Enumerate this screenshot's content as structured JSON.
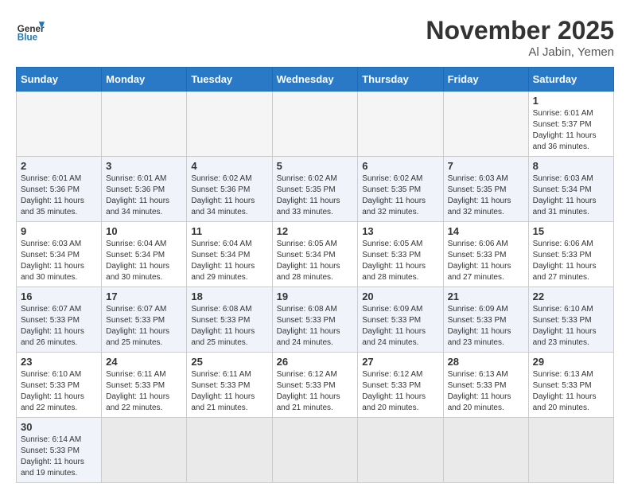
{
  "header": {
    "logo_general": "General",
    "logo_blue": "Blue",
    "month_title": "November 2025",
    "location": "Al Jabin, Yemen"
  },
  "weekdays": [
    "Sunday",
    "Monday",
    "Tuesday",
    "Wednesday",
    "Thursday",
    "Friday",
    "Saturday"
  ],
  "weeks": [
    [
      {
        "day": "",
        "info": ""
      },
      {
        "day": "",
        "info": ""
      },
      {
        "day": "",
        "info": ""
      },
      {
        "day": "",
        "info": ""
      },
      {
        "day": "",
        "info": ""
      },
      {
        "day": "",
        "info": ""
      },
      {
        "day": "1",
        "info": "Sunrise: 6:01 AM\nSunset: 5:37 PM\nDaylight: 11 hours and 36 minutes."
      }
    ],
    [
      {
        "day": "2",
        "info": "Sunrise: 6:01 AM\nSunset: 5:36 PM\nDaylight: 11 hours and 35 minutes."
      },
      {
        "day": "3",
        "info": "Sunrise: 6:01 AM\nSunset: 5:36 PM\nDaylight: 11 hours and 34 minutes."
      },
      {
        "day": "4",
        "info": "Sunrise: 6:02 AM\nSunset: 5:36 PM\nDaylight: 11 hours and 34 minutes."
      },
      {
        "day": "5",
        "info": "Sunrise: 6:02 AM\nSunset: 5:35 PM\nDaylight: 11 hours and 33 minutes."
      },
      {
        "day": "6",
        "info": "Sunrise: 6:02 AM\nSunset: 5:35 PM\nDaylight: 11 hours and 32 minutes."
      },
      {
        "day": "7",
        "info": "Sunrise: 6:03 AM\nSunset: 5:35 PM\nDaylight: 11 hours and 32 minutes."
      },
      {
        "day": "8",
        "info": "Sunrise: 6:03 AM\nSunset: 5:34 PM\nDaylight: 11 hours and 31 minutes."
      }
    ],
    [
      {
        "day": "9",
        "info": "Sunrise: 6:03 AM\nSunset: 5:34 PM\nDaylight: 11 hours and 30 minutes."
      },
      {
        "day": "10",
        "info": "Sunrise: 6:04 AM\nSunset: 5:34 PM\nDaylight: 11 hours and 30 minutes."
      },
      {
        "day": "11",
        "info": "Sunrise: 6:04 AM\nSunset: 5:34 PM\nDaylight: 11 hours and 29 minutes."
      },
      {
        "day": "12",
        "info": "Sunrise: 6:05 AM\nSunset: 5:34 PM\nDaylight: 11 hours and 28 minutes."
      },
      {
        "day": "13",
        "info": "Sunrise: 6:05 AM\nSunset: 5:33 PM\nDaylight: 11 hours and 28 minutes."
      },
      {
        "day": "14",
        "info": "Sunrise: 6:06 AM\nSunset: 5:33 PM\nDaylight: 11 hours and 27 minutes."
      },
      {
        "day": "15",
        "info": "Sunrise: 6:06 AM\nSunset: 5:33 PM\nDaylight: 11 hours and 27 minutes."
      }
    ],
    [
      {
        "day": "16",
        "info": "Sunrise: 6:07 AM\nSunset: 5:33 PM\nDaylight: 11 hours and 26 minutes."
      },
      {
        "day": "17",
        "info": "Sunrise: 6:07 AM\nSunset: 5:33 PM\nDaylight: 11 hours and 25 minutes."
      },
      {
        "day": "18",
        "info": "Sunrise: 6:08 AM\nSunset: 5:33 PM\nDaylight: 11 hours and 25 minutes."
      },
      {
        "day": "19",
        "info": "Sunrise: 6:08 AM\nSunset: 5:33 PM\nDaylight: 11 hours and 24 minutes."
      },
      {
        "day": "20",
        "info": "Sunrise: 6:09 AM\nSunset: 5:33 PM\nDaylight: 11 hours and 24 minutes."
      },
      {
        "day": "21",
        "info": "Sunrise: 6:09 AM\nSunset: 5:33 PM\nDaylight: 11 hours and 23 minutes."
      },
      {
        "day": "22",
        "info": "Sunrise: 6:10 AM\nSunset: 5:33 PM\nDaylight: 11 hours and 23 minutes."
      }
    ],
    [
      {
        "day": "23",
        "info": "Sunrise: 6:10 AM\nSunset: 5:33 PM\nDaylight: 11 hours and 22 minutes."
      },
      {
        "day": "24",
        "info": "Sunrise: 6:11 AM\nSunset: 5:33 PM\nDaylight: 11 hours and 22 minutes."
      },
      {
        "day": "25",
        "info": "Sunrise: 6:11 AM\nSunset: 5:33 PM\nDaylight: 11 hours and 21 minutes."
      },
      {
        "day": "26",
        "info": "Sunrise: 6:12 AM\nSunset: 5:33 PM\nDaylight: 11 hours and 21 minutes."
      },
      {
        "day": "27",
        "info": "Sunrise: 6:12 AM\nSunset: 5:33 PM\nDaylight: 11 hours and 20 minutes."
      },
      {
        "day": "28",
        "info": "Sunrise: 6:13 AM\nSunset: 5:33 PM\nDaylight: 11 hours and 20 minutes."
      },
      {
        "day": "29",
        "info": "Sunrise: 6:13 AM\nSunset: 5:33 PM\nDaylight: 11 hours and 20 minutes."
      }
    ],
    [
      {
        "day": "30",
        "info": "Sunrise: 6:14 AM\nSunset: 5:33 PM\nDaylight: 11 hours and 19 minutes."
      },
      {
        "day": "",
        "info": ""
      },
      {
        "day": "",
        "info": ""
      },
      {
        "day": "",
        "info": ""
      },
      {
        "day": "",
        "info": ""
      },
      {
        "day": "",
        "info": ""
      },
      {
        "day": "",
        "info": ""
      }
    ]
  ]
}
